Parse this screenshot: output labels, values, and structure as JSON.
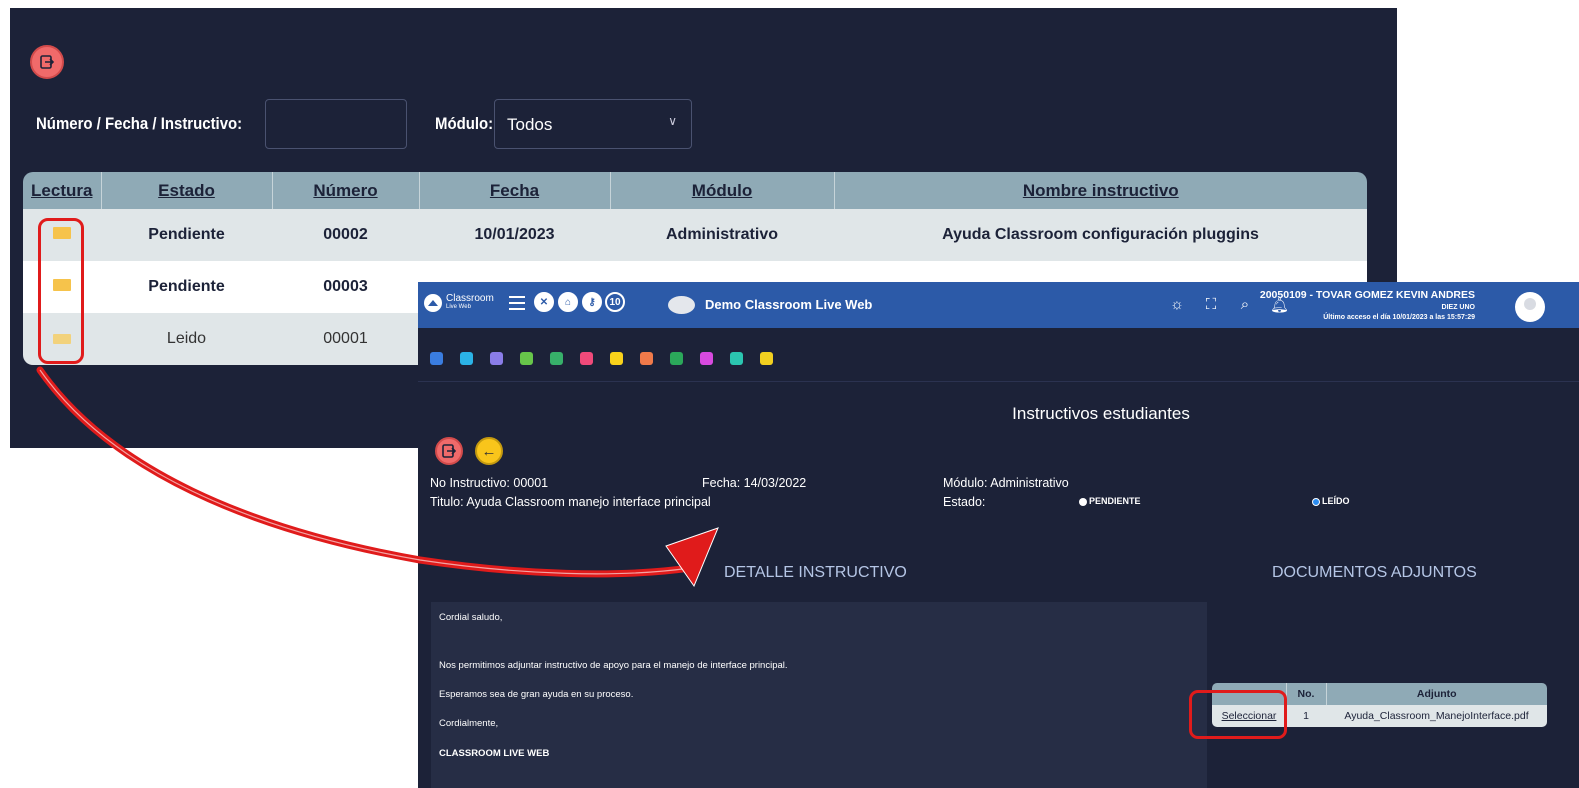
{
  "back": {
    "filter_label_1": "Número / Fecha / Instructivo:",
    "filter_value": "",
    "filter_label_2": "Módulo:",
    "module_selected": "Todos",
    "table": {
      "headers": [
        "Lectura",
        "Estado",
        "Número",
        "Fecha",
        "Módulo",
        "Nombre instructivo"
      ],
      "rows": [
        {
          "estado": "Pendiente",
          "numero": "00002",
          "fecha": "10/01/2023",
          "modulo": "Administrativo",
          "nombre": "Ayuda Classroom configuración pluggins"
        },
        {
          "estado": "Pendiente",
          "numero": "00003",
          "fecha": "",
          "modulo": "",
          "nombre": ""
        },
        {
          "estado": "Leido",
          "numero": "00001",
          "fecha": "",
          "modulo": "",
          "nombre": ""
        }
      ]
    }
  },
  "front": {
    "logo_text": "Classroom",
    "logo_sub": "Live Web",
    "top_circle_4": "10",
    "demo_title": "Demo Classroom Live Web",
    "user_name": "20050109 - TOVAR GOMEZ KEVIN ANDRES",
    "user_group": "DIEZ UNO",
    "last_access": "Último acceso el día 10/01/2023 a las 15:57:29",
    "page_title": "Instructivos estudiantes",
    "no_instructivo": "No Instructivo: 00001",
    "fecha": "Fecha: 14/03/2022",
    "modulo": "Módulo: Administrativo",
    "titulo": "Titulo: Ayuda Classroom manejo interface principal",
    "estado_label": "Estado:",
    "radio_pendiente": "PENDIENTE",
    "radio_leido": "LEÍDO",
    "detalle_title": "DETALLE INSTRUCTIVO",
    "adjuntos_title": "DOCUMENTOS ADJUNTOS",
    "detail_lines": [
      "Cordial saludo,",
      "Nos permitimos adjuntar instructivo de apoyo para el manejo de interface principal.",
      "Esperamos sea de gran ayuda en su proceso.",
      "Cordialmente,",
      "CLASSROOM LIVE WEB"
    ],
    "adjuntos": {
      "headers": [
        "",
        "No.",
        "Adjunto"
      ],
      "row": {
        "action": "Seleccionar",
        "no": "1",
        "file": "Ayuda_Classroom_ManejoInterface.pdf"
      }
    },
    "module_colors": [
      "#3a7de0",
      "#2bb3e6",
      "#8a7de8",
      "#67c64a",
      "#37b06a",
      "#f04a7a",
      "#f9d21b",
      "#f07a4a",
      "#2ba85a",
      "#d84ae0",
      "#2bc6b0",
      "#f2d020"
    ]
  },
  "colors": {
    "dark_bg": "#1c2238",
    "header_blue": "#2c5aa8",
    "table_header": "#8faab6",
    "highlight_red": "#e01b1b"
  }
}
